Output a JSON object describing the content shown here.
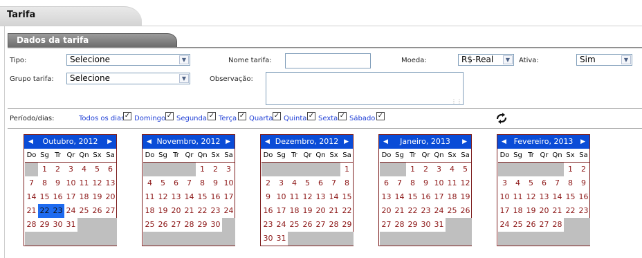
{
  "tab": {
    "title": "Tarifa"
  },
  "section": {
    "title": "Dados da tarifa"
  },
  "form": {
    "tipo_label": "Tipo:",
    "tipo_value": "Selecione",
    "nome_label": "Nome tarifa:",
    "nome_value": "",
    "moeda_label": "Moeda:",
    "moeda_value": "R$-Real",
    "ativa_label": "Ativa:",
    "ativa_value": "Sim",
    "grupo_label": "Grupo tarifa:",
    "grupo_value": "Selecione",
    "obs_label": "Observação:"
  },
  "period": {
    "label": "Período/dias:",
    "days": [
      {
        "label": "Todos os dias",
        "checked": true
      },
      {
        "label": "Domingo",
        "checked": true
      },
      {
        "label": "Segunda",
        "checked": true
      },
      {
        "label": "Terça",
        "checked": true
      },
      {
        "label": "Quarta",
        "checked": true
      },
      {
        "label": "Quinta",
        "checked": true
      },
      {
        "label": "Sexta",
        "checked": true
      },
      {
        "label": "Sábado",
        "checked": true
      }
    ],
    "refresh_icon": "refresh-icon"
  },
  "calendars": [
    {
      "title": "Outubro, 2012",
      "offset": 1,
      "days": 31,
      "selected": [
        22,
        23
      ]
    },
    {
      "title": "Novembro, 2012",
      "offset": 4,
      "days": 30,
      "selected": []
    },
    {
      "title": "Dezembro, 2012",
      "offset": 6,
      "days": 31,
      "selected": []
    },
    {
      "title": "Janeiro, 2013",
      "offset": 2,
      "days": 31,
      "selected": []
    },
    {
      "title": "Fevereiro, 2013",
      "offset": 5,
      "days": 28,
      "selected": []
    }
  ],
  "weekdays": [
    "Do",
    "Sg",
    "Tr",
    "Qr",
    "Qn",
    "Sx",
    "Sa"
  ],
  "nav": {
    "prev": "◀",
    "next": "▶"
  },
  "colors": {
    "header_blue": "#0a4cd7",
    "day_text": "#8b1414",
    "selected": "#1e6bf0",
    "link": "#1f3fd6"
  }
}
